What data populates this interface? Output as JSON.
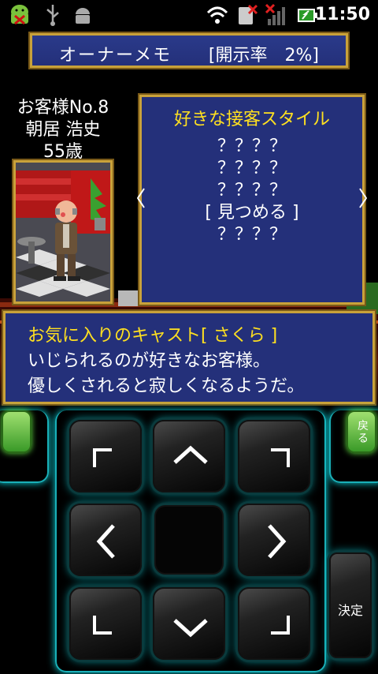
{
  "status_bar": {
    "time": "11:50",
    "icons": [
      "android-debug-icon",
      "usb-icon",
      "android-icon",
      "wifi-icon",
      "no-sim-icon",
      "signal-icon",
      "battery-icon"
    ]
  },
  "memo": {
    "title": "オーナーメモ",
    "disclosure": "[開示率　2%]"
  },
  "customer": {
    "number": "お客様No.8",
    "name": "朝居 浩史",
    "age": "55歳"
  },
  "style_panel": {
    "heading": "好きな接客スタイル",
    "lines": [
      "？？？？",
      "？？？？",
      "？？？？",
      "[ 見つめる ]",
      "？？？？"
    ]
  },
  "message": {
    "line1": "お気に入りのキャスト[ さくら ]",
    "line2": "いじられるのが好きなお客様。",
    "line3": "優しくされると寂しくなるようだ。"
  },
  "controls": {
    "back_label": "戻る",
    "ok_label": "決定"
  },
  "colors": {
    "panel_blue": "#24307a",
    "frame_gold": "#c9a23a",
    "highlight_yellow": "#ffe020",
    "neon_cyan": "#0ad0d8",
    "button_green": "#3a9a28"
  }
}
